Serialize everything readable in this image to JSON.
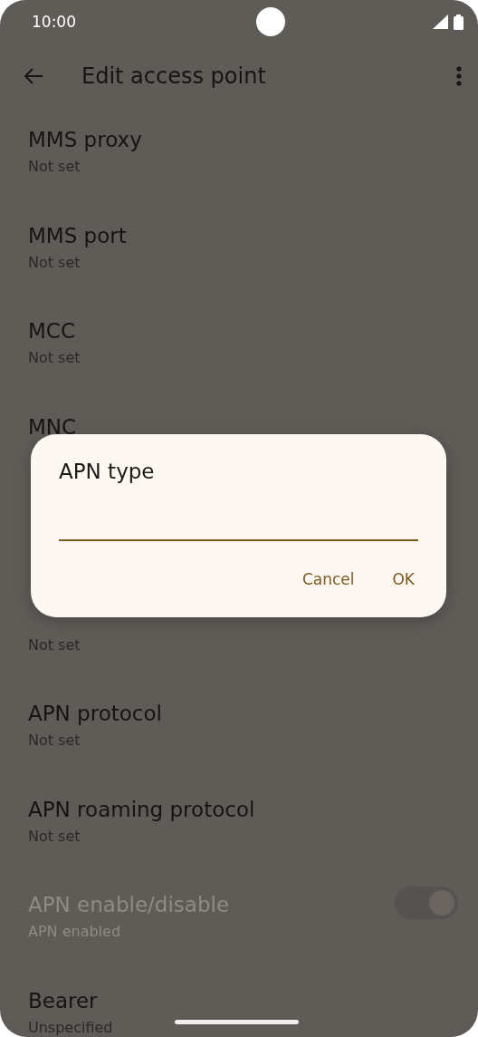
{
  "status_bar": {
    "time": "10:00"
  },
  "toolbar": {
    "title": "Edit access point"
  },
  "settings": [
    {
      "kind": "text",
      "title": "MMS proxy",
      "summary": "Not set",
      "disabled": false
    },
    {
      "kind": "text",
      "title": "MMS port",
      "summary": "Not set",
      "disabled": false
    },
    {
      "kind": "text",
      "title": "MCC",
      "summary": "Not set",
      "disabled": false
    },
    {
      "kind": "text",
      "title": "MNC",
      "disabled": false
    },
    {
      "kind": "text"
    },
    {
      "kind": "text",
      "summary": "Not set",
      "disabled": false
    },
    {
      "kind": "text",
      "title": "APN protocol",
      "summary": "Not set",
      "disabled": false
    },
    {
      "kind": "text",
      "title": "APN roaming protocol",
      "summary": "Not set",
      "disabled": false
    },
    {
      "kind": "switch",
      "title": "APN enable/disable",
      "summary": "APN enabled",
      "disabled": true,
      "on": true
    },
    {
      "kind": "text",
      "title": "Bearer",
      "summary": "Unspecified",
      "disabled": false
    }
  ],
  "dialog": {
    "title": "APN type",
    "buttons": [
      "Cancel",
      "OK"
    ]
  }
}
